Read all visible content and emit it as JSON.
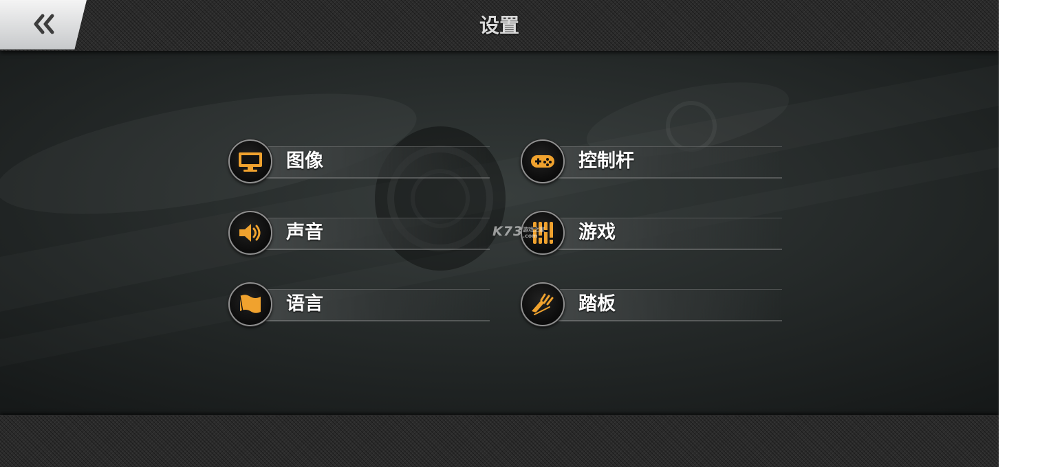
{
  "header": {
    "title": "设置",
    "back_icon": "double-chevron-left-icon"
  },
  "menu": {
    "items": [
      {
        "label": "图像",
        "icon": "monitor-icon"
      },
      {
        "label": "控制杆",
        "icon": "gamepad-icon"
      },
      {
        "label": "声音",
        "icon": "speaker-icon"
      },
      {
        "label": "游戏",
        "icon": "sliders-icon"
      },
      {
        "label": "语言",
        "icon": "flag-icon"
      },
      {
        "label": "踏板",
        "icon": "pedal-icon"
      }
    ]
  },
  "watermark": {
    "main": "K73",
    "sub": "游戏之家 .com"
  },
  "colors": {
    "accent": "#f0a22e",
    "background": "#1c2020",
    "bar": "#2b2b2b"
  }
}
